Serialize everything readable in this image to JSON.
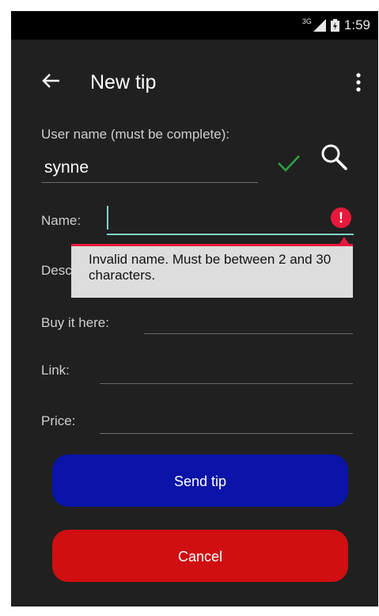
{
  "status_bar": {
    "network": "3G",
    "time": "1:59"
  },
  "app_bar": {
    "title": "New tip",
    "back_icon": "arrow-left-icon",
    "menu_icon": "more-vert-icon"
  },
  "form": {
    "username": {
      "label": "User name (must be complete):",
      "value": "synne",
      "valid_icon": "check-icon",
      "search_icon": "search-icon"
    },
    "name": {
      "label": "Name:",
      "value": "",
      "error_icon": "error-icon",
      "error_symbol": "!",
      "error_message": "Invalid name. Must be between 2 and 30 characters."
    },
    "description": {
      "label": "Description:",
      "value": ""
    },
    "buy_it_here": {
      "label": "Buy it here:",
      "value": ""
    },
    "link": {
      "label": "Link:",
      "value": ""
    },
    "price": {
      "label": "Price:",
      "value": ""
    }
  },
  "buttons": {
    "send": "Send tip",
    "cancel": "Cancel"
  },
  "colors": {
    "background": "#202020",
    "send_button": "#0a14a8",
    "cancel_button": "#cf0f12",
    "error": "#e6193c",
    "valid": "#2ea043",
    "focus": "#7fd3c5"
  }
}
